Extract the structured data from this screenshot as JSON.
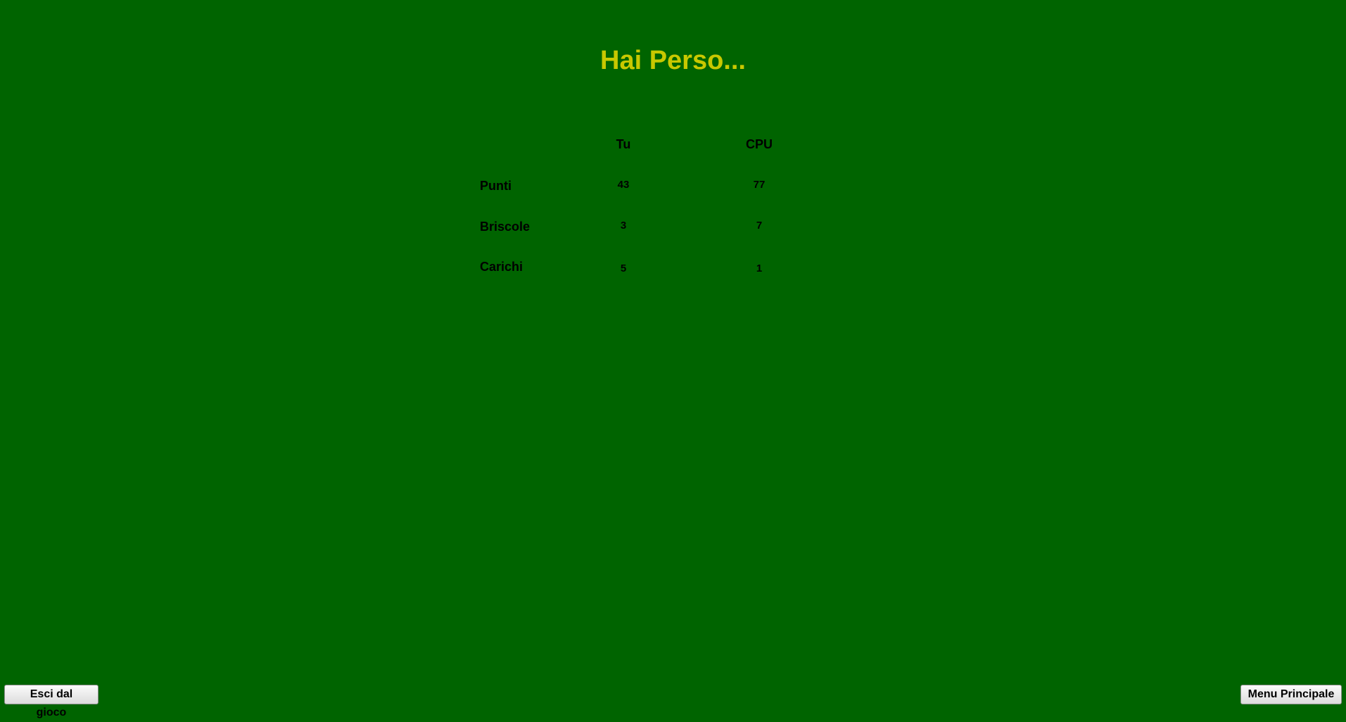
{
  "result": {
    "title": "Hai Perso..."
  },
  "scoreboard": {
    "columns": [
      "Tu",
      "CPU"
    ],
    "rows": [
      {
        "label": "Punti",
        "you": "43",
        "cpu": "77"
      },
      {
        "label": "Briscole",
        "you": "3",
        "cpu": "7"
      },
      {
        "label": "Carichi",
        "you": "5",
        "cpu": "1"
      }
    ]
  },
  "buttons": {
    "exit_label": "Esci dal gioco",
    "menu_label": "Menu Principale"
  },
  "colors": {
    "background": "#006400",
    "title": "#c8c800"
  }
}
